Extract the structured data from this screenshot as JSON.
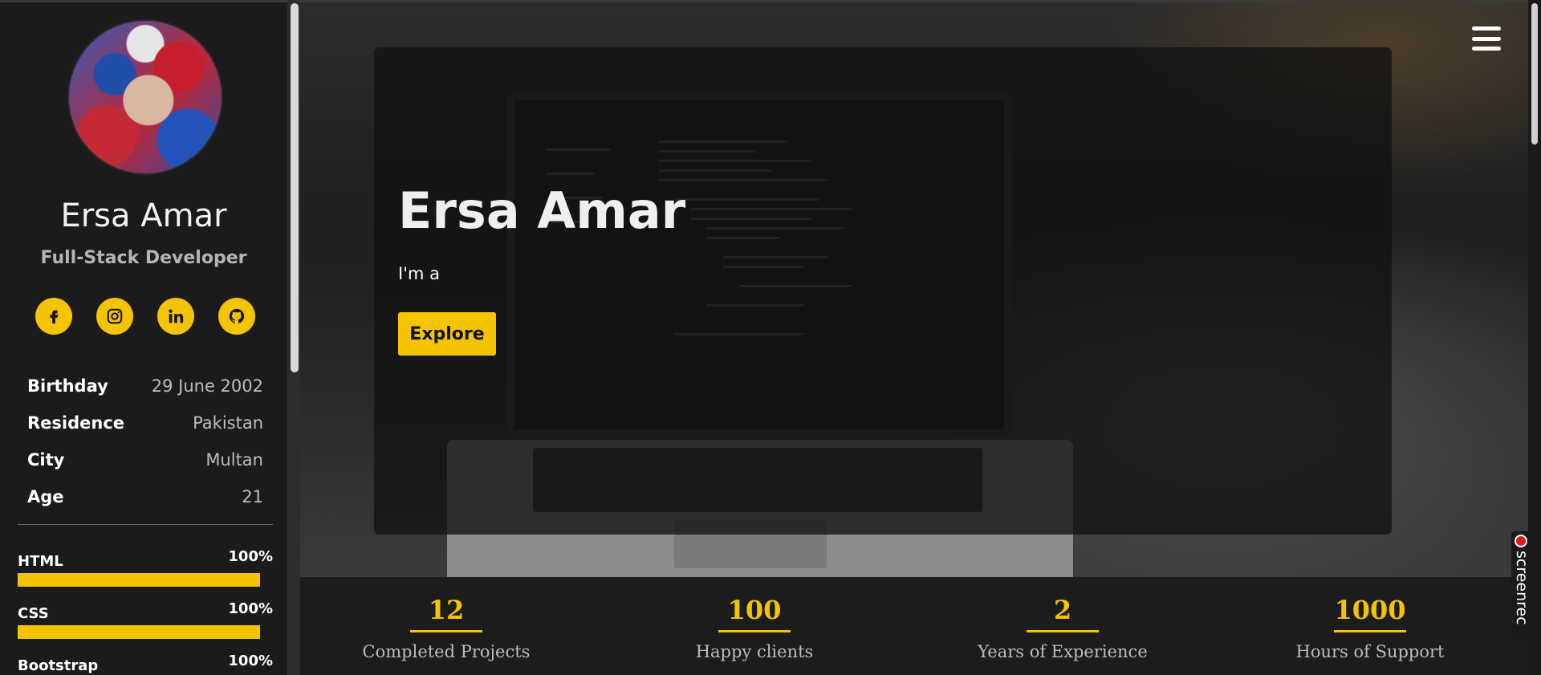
{
  "sidebar": {
    "name": "Ersa Amar",
    "role": "Full-Stack Developer",
    "socials": [
      {
        "icon": "facebook-icon"
      },
      {
        "icon": "instagram-icon"
      },
      {
        "icon": "linkedin-icon"
      },
      {
        "icon": "github-icon"
      }
    ],
    "info": [
      {
        "key": "Birthday",
        "value": "29 June 2002"
      },
      {
        "key": "Residence",
        "value": "Pakistan"
      },
      {
        "key": "City",
        "value": "Multan"
      },
      {
        "key": "Age",
        "value": "21"
      }
    ],
    "skills": [
      {
        "name": "HTML",
        "percent_label": "100%",
        "level": 1.0
      },
      {
        "name": "CSS",
        "percent_label": "100%",
        "level": 1.0
      },
      {
        "name": "Bootstrap",
        "percent_label": "100%",
        "level": 1.0
      }
    ]
  },
  "hero": {
    "title": "Ersa Amar",
    "subtitle": "I'm a",
    "button": "Explore"
  },
  "menu_icon": "hamburger-menu-icon",
  "counters": [
    {
      "number": "12",
      "label": "Completed Projects"
    },
    {
      "number": "100",
      "label": "Happy clients"
    },
    {
      "number": "2",
      "label": "Years of Experience"
    },
    {
      "number": "1000",
      "label": "Hours of Support"
    }
  ],
  "screenrec": {
    "label": "screenrec"
  },
  "colors": {
    "accent": "#f5c400",
    "background": "#1c1c1c"
  }
}
